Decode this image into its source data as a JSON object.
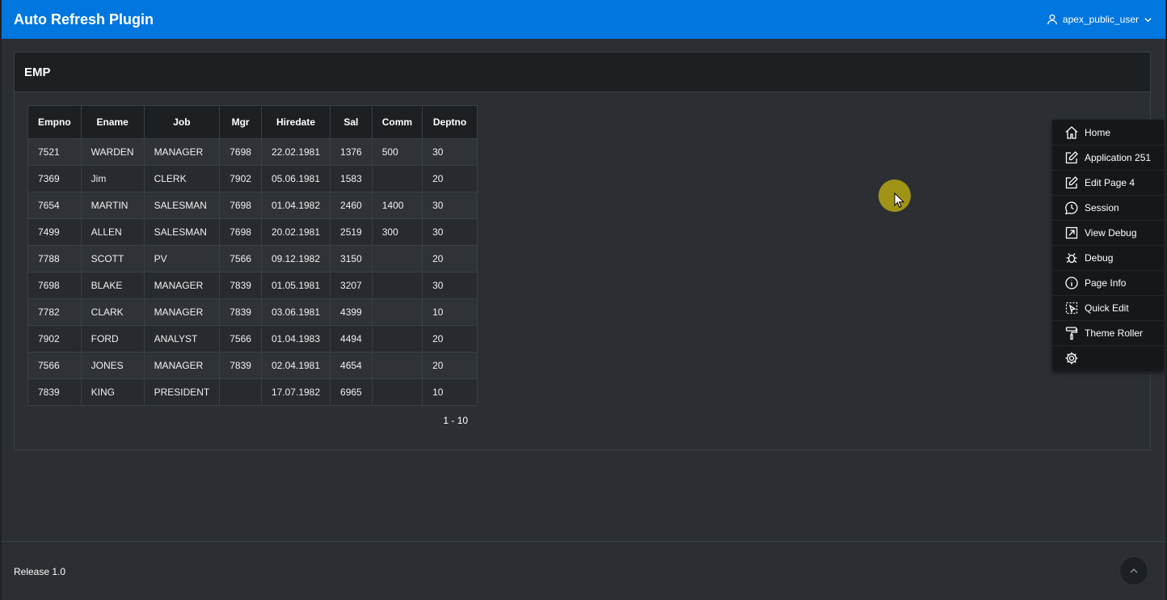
{
  "header": {
    "app_title": "Auto Refresh Plugin",
    "user_name": "apex_public_user",
    "user_icon": "user-icon",
    "dropdown_icon": "chevron-down-icon"
  },
  "region": {
    "title": "EMP"
  },
  "report": {
    "columns": [
      "Empno",
      "Ename",
      "Job",
      "Mgr",
      "Hiredate",
      "Sal",
      "Comm",
      "Deptno"
    ],
    "rows": [
      [
        "7521",
        "WARDEN",
        "MANAGER",
        "7698",
        "22.02.1981",
        "1376",
        "500",
        "30"
      ],
      [
        "7369",
        "Jim",
        "CLERK",
        "7902",
        "05.06.1981",
        "1583",
        "",
        "20"
      ],
      [
        "7654",
        "MARTIN",
        "SALESMAN",
        "7698",
        "01.04.1982",
        "2460",
        "1400",
        "30"
      ],
      [
        "7499",
        "ALLEN",
        "SALESMAN",
        "7698",
        "20.02.1981",
        "2519",
        "300",
        "30"
      ],
      [
        "7788",
        "SCOTT",
        "PV",
        "7566",
        "09.12.1982",
        "3150",
        "",
        "20"
      ],
      [
        "7698",
        "BLAKE",
        "MANAGER",
        "7839",
        "01.05.1981",
        "3207",
        "",
        "30"
      ],
      [
        "7782",
        "CLARK",
        "MANAGER",
        "7839",
        "03.06.1981",
        "4399",
        "",
        "10"
      ],
      [
        "7902",
        "FORD",
        "ANALYST",
        "7566",
        "01.04.1983",
        "4494",
        "",
        "20"
      ],
      [
        "7566",
        "JONES",
        "MANAGER",
        "7839",
        "02.04.1981",
        "4654",
        "",
        "20"
      ],
      [
        "7839",
        "KING",
        "PRESIDENT",
        "",
        "17.07.1982",
        "6965",
        "",
        "10"
      ]
    ],
    "pagination": "1 - 10"
  },
  "devbar": {
    "items": [
      {
        "label": "Home",
        "icon": "home-icon"
      },
      {
        "label": "Application 251",
        "icon": "edit-icon"
      },
      {
        "label": "Edit Page 4",
        "icon": "edit-icon"
      },
      {
        "label": "Session",
        "icon": "session-icon"
      },
      {
        "label": "View Debug",
        "icon": "external-link-icon"
      },
      {
        "label": "Debug",
        "icon": "bug-icon"
      },
      {
        "label": "Page Info",
        "icon": "info-icon"
      },
      {
        "label": "Quick Edit",
        "icon": "quick-edit-icon"
      },
      {
        "label": "Theme Roller",
        "icon": "paint-roller-icon"
      },
      {
        "label": "",
        "icon": "gear-icon"
      }
    ]
  },
  "footer": {
    "release": "Release 1.0",
    "top_icon": "chevron-up-icon"
  },
  "colors": {
    "header_bg": "#0076df",
    "page_bg": "#2b2f33",
    "region_header_bg": "#1d2023",
    "devbar_bg": "#15181a",
    "cursor_highlight": "#b5a612"
  }
}
